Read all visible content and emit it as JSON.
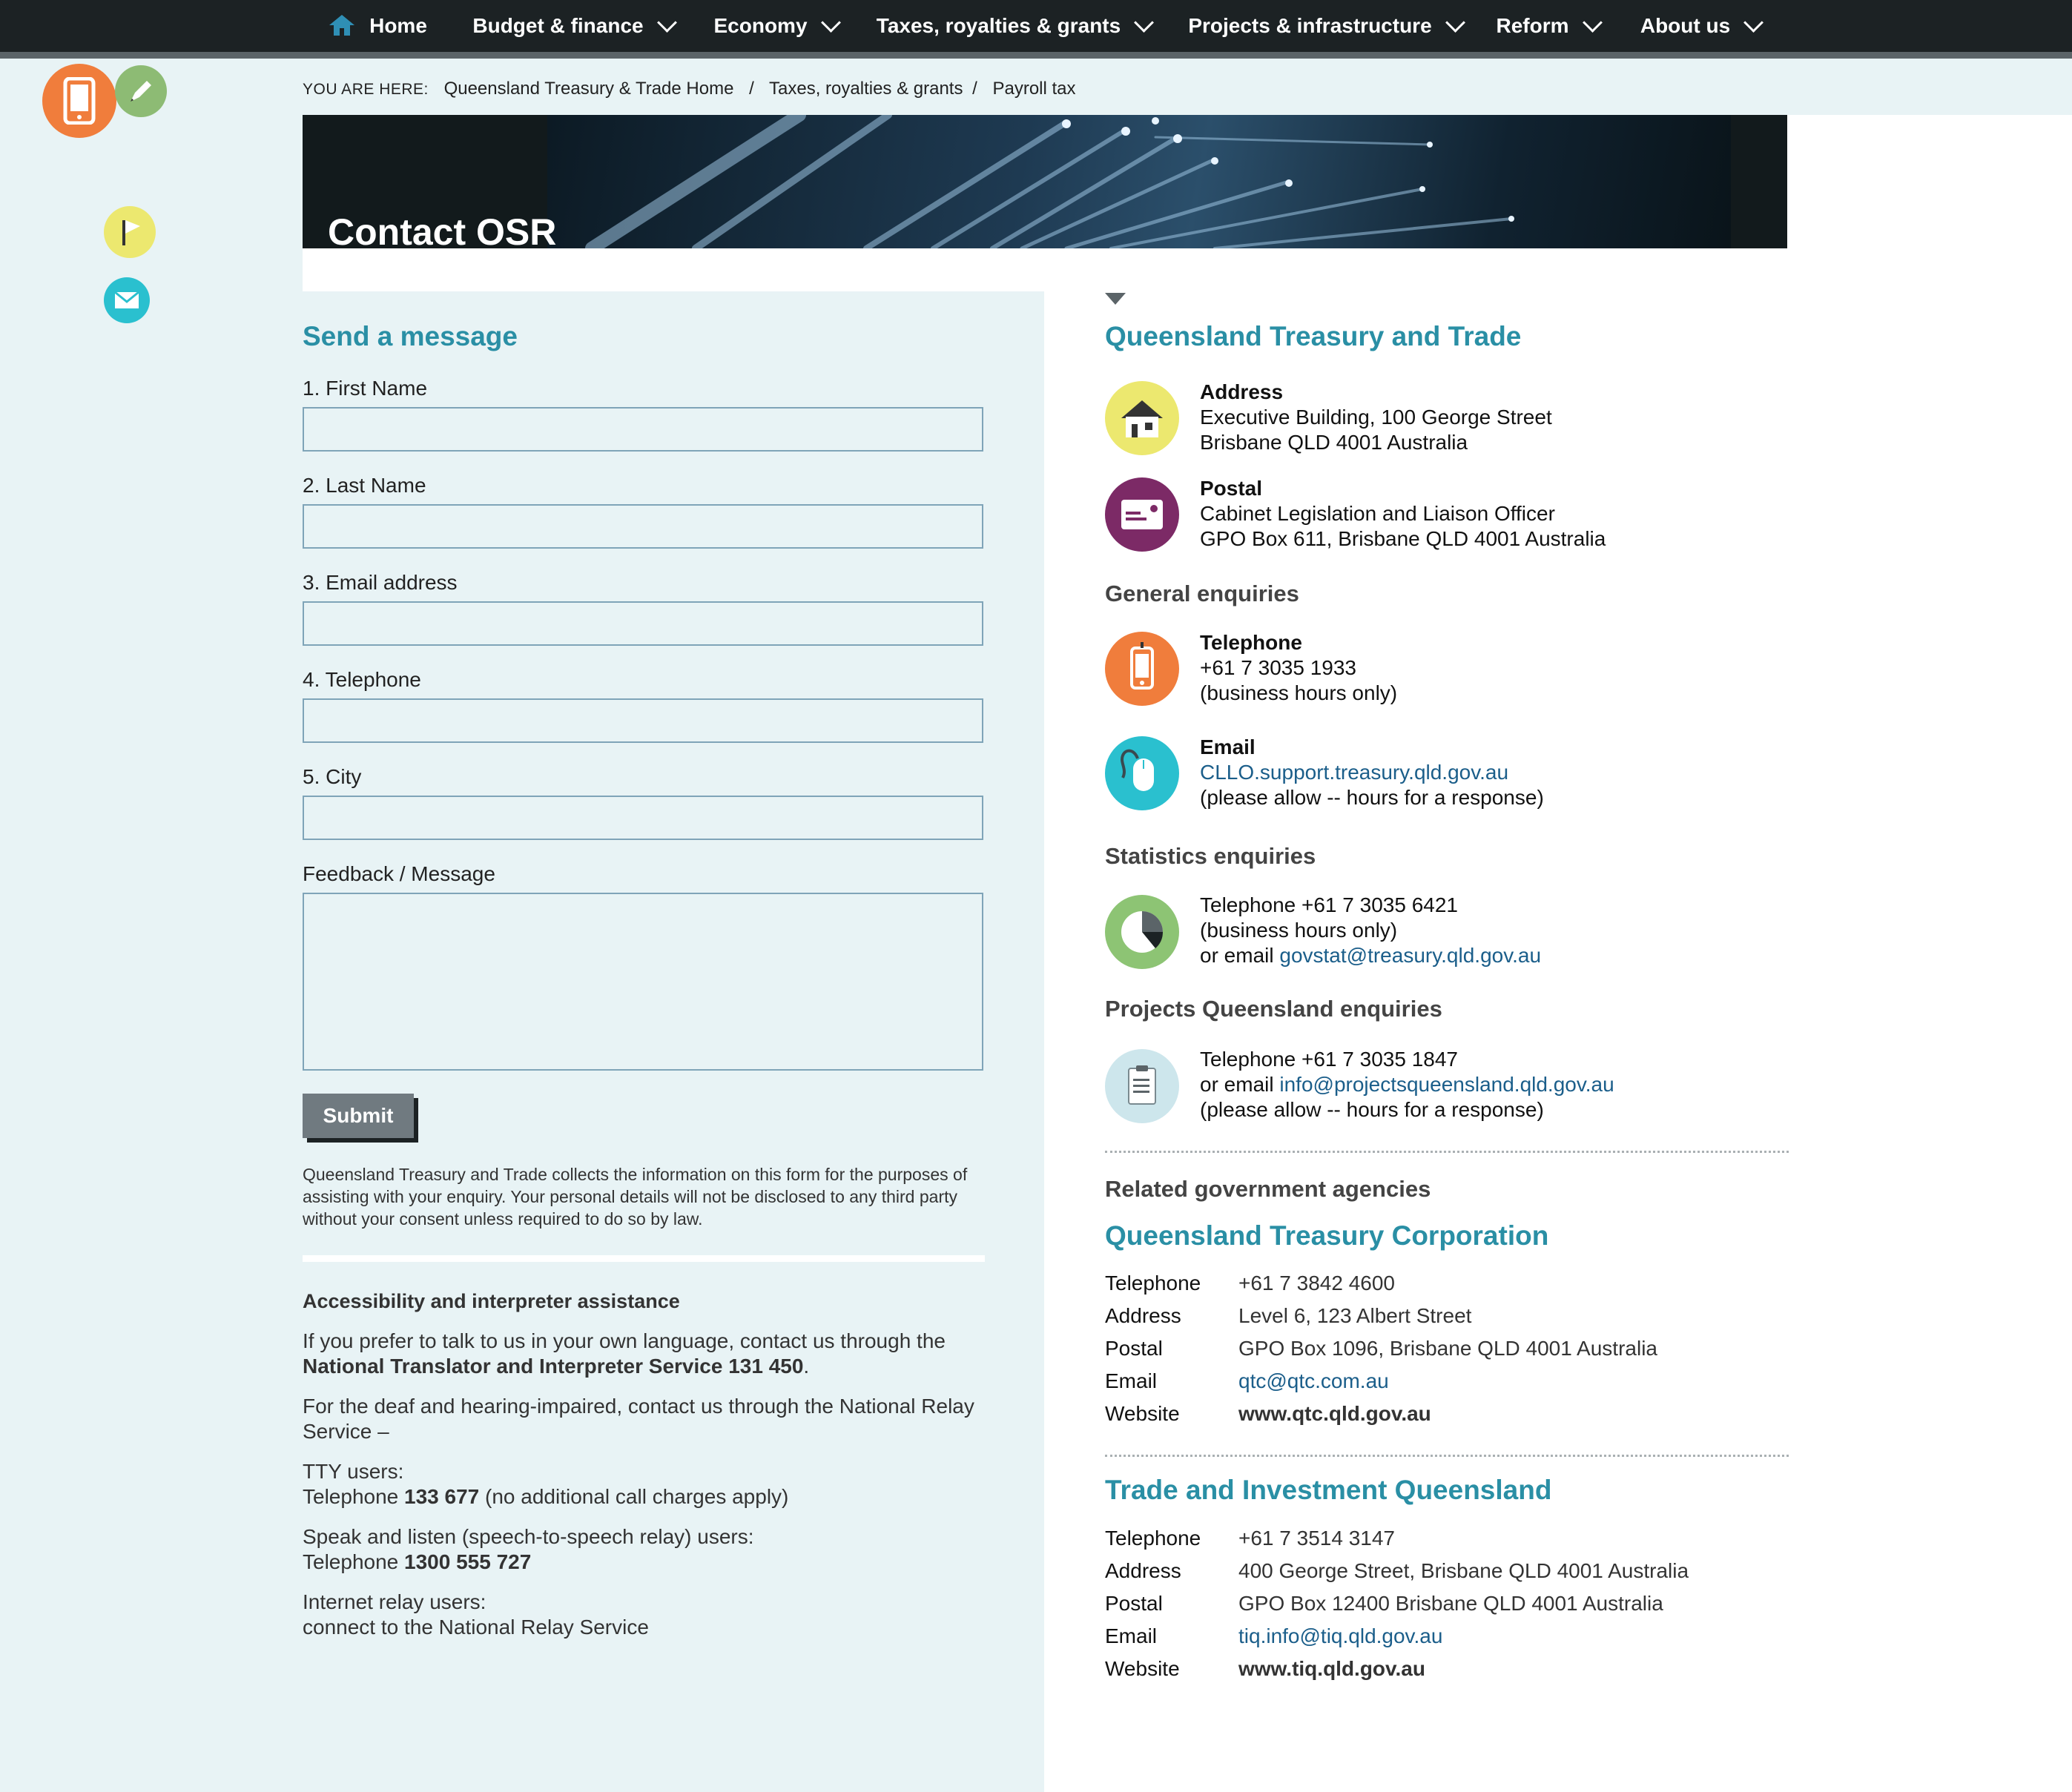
{
  "nav": {
    "items": [
      {
        "label": "Home",
        "color": "#2f8fb5"
      },
      {
        "label": "Budget & finance",
        "color": "#9aa3a7"
      },
      {
        "label": "Economy",
        "color": "#49c1cf"
      },
      {
        "label": "Taxes, royalties & grants",
        "color": "#8a2a6a"
      },
      {
        "label": "Projects & infrastructure",
        "color": "#2b5f86"
      },
      {
        "label": "Reform",
        "color": "#7ab05a"
      },
      {
        "label": "About us",
        "color": "#e5dc4a"
      }
    ]
  },
  "breadcrumb": {
    "label": "YOU ARE HERE:",
    "items": [
      "Queensland Treasury & Trade Home",
      "Taxes, royalties & grants",
      "Payroll tax"
    ],
    "sep": "/"
  },
  "banner": {
    "title": "Contact OSR"
  },
  "form": {
    "heading": "Send a message",
    "fields": [
      {
        "label": "1.  First Name",
        "value": ""
      },
      {
        "label": "2.  Last Name",
        "value": ""
      },
      {
        "label": "3.  Email address",
        "value": ""
      },
      {
        "label": "4.  Telephone",
        "value": ""
      },
      {
        "label": "5.  City",
        "value": ""
      }
    ],
    "message_label": "Feedback / Message",
    "message_value": "",
    "submit": "Submit",
    "privacy": "Queensland Treasury and Trade collects the information on this form for the purposes of assisting with your enquiry. Your personal details will not be disclosed to any third party without your consent unless required to do so by law."
  },
  "accessibility": {
    "heading": "Accessibility and interpreter assistance",
    "p1_a": "If you prefer to talk to us in your own language, contact us through the ",
    "p1_b": "National Translator and Interpreter Service 131 450",
    "p1_c": ".",
    "p2": "For the deaf and hearing-impaired, contact us through the National Relay Service –",
    "p3_title": "TTY users:",
    "p3_a": "Telephone ",
    "p3_b": "133 677",
    "p3_c": " (no additional call charges apply)",
    "p4_title": "Speak and listen (speech-to-speech relay) users:",
    "p4_a": "Telephone ",
    "p4_b": "1300 555 727",
    "p5_title": "Internet relay users:",
    "p5_a": "connect to the National Relay Service"
  },
  "contact": {
    "org": "Queensland Treasury and Trade",
    "address_title": "Address",
    "address_l1": "Executive Building, 100 George Street",
    "address_l2": "Brisbane QLD 4001 Australia",
    "postal_title": "Postal",
    "postal_l1": "Cabinet Legislation and Liaison Officer",
    "postal_l2": "GPO Box 611, Brisbane QLD 4001 Australia",
    "general_heading": "General enquiries",
    "tel_title": "Telephone",
    "tel_l1": "+61 7 3035 1933",
    "tel_l2": "(business hours only)",
    "email_title": "Email",
    "email_link": "CLLO.support.treasury.qld.gov.au",
    "email_note": "(please allow -- hours for a response)",
    "stats_heading": "Statistics enquiries",
    "stats_l1": "Telephone +61 7 3035 6421",
    "stats_l2": "(business hours only)",
    "stats_l3_a": "or email ",
    "stats_l3_link": "govstat@treasury.qld.gov.au",
    "projects_heading": "Projects Queensland enquiries",
    "proj_l1": "Telephone +61 7 3035 1847",
    "proj_l2_a": "or email ",
    "proj_l2_link": "info@projectsqueensland.qld.gov.au",
    "proj_l3": "(please allow -- hours for a response)"
  },
  "related": {
    "heading": "Related government agencies",
    "agencies": [
      {
        "name": "Queensland Treasury Corporation",
        "rows": [
          {
            "label": "Telephone",
            "value": "+61 7 3842 4600"
          },
          {
            "label": "Address",
            "value": "Level 6, 123 Albert Street"
          },
          {
            "label": "Postal",
            "value": "GPO Box 1096, Brisbane QLD 4001 Australia"
          },
          {
            "label": "Email",
            "value": "qtc@qtc.com.au"
          },
          {
            "label": "Website",
            "value": "www.qtc.qld.gov.au"
          }
        ]
      },
      {
        "name": "Trade and Investment Queensland",
        "rows": [
          {
            "label": "Telephone",
            "value": "+61 7 3514 3147"
          },
          {
            "label": "Address",
            "value": "400 George Street, Brisbane QLD 4001 Australia"
          },
          {
            "label": "Postal",
            "value": "GPO Box 12400 Brisbane QLD 4001 Australia"
          },
          {
            "label": "Email",
            "value": "tiq.info@tiq.qld.gov.au"
          },
          {
            "label": "Website",
            "value": "www.tiq.qld.gov.au"
          }
        ]
      }
    ]
  },
  "colors": {
    "teal_heading": "#2a8fa5",
    "link": "#1b5e8a",
    "pale_bg": "#e8f3f5",
    "nav_bg": "#1c2224"
  },
  "icons": {
    "side": [
      "phone-icon",
      "pencil-icon",
      "flag-icon",
      "mail-icon"
    ],
    "contact": [
      "house-icon",
      "postcard-icon",
      "phone-icon",
      "mouse-icon",
      "pie-chart-icon",
      "clipboard-icon"
    ]
  }
}
